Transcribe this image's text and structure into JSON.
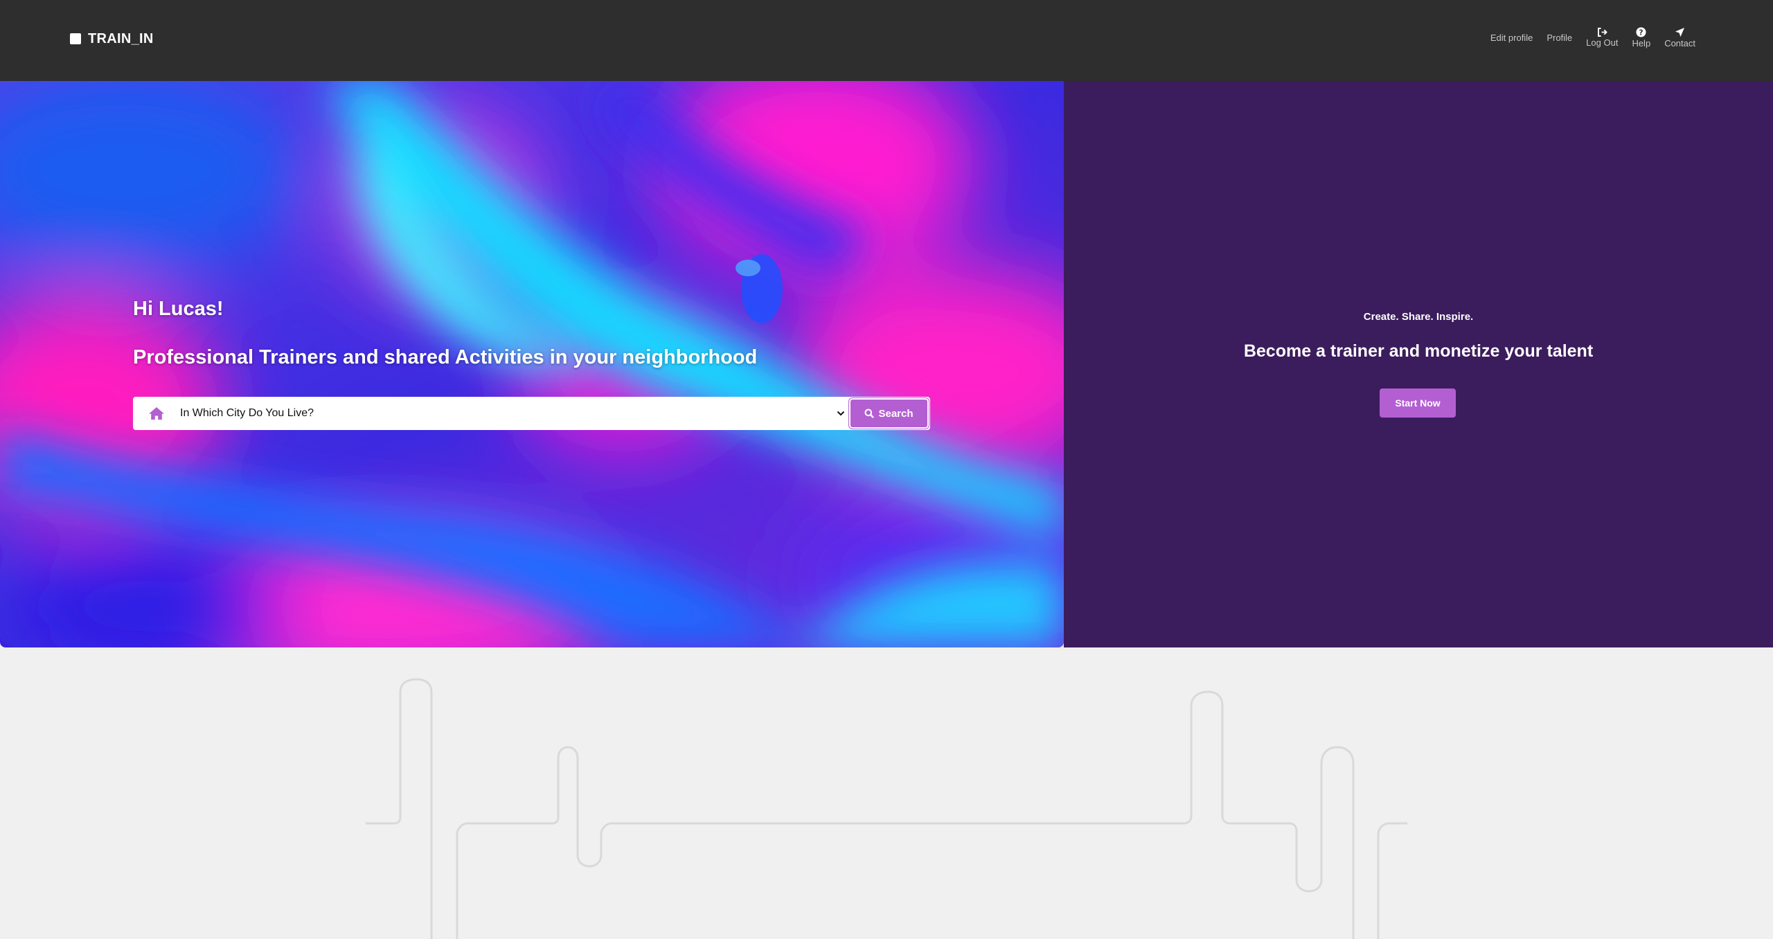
{
  "nav": {
    "brand": "TRAIN_IN",
    "links": [
      {
        "label": "Edit profile",
        "icon": null
      },
      {
        "label": "Profile",
        "icon": null
      },
      {
        "label": "Log Out",
        "icon": "sign-out-icon"
      },
      {
        "label": "Help",
        "icon": "question-circle-icon"
      },
      {
        "label": "Contact",
        "icon": "paper-plane-icon"
      }
    ]
  },
  "hero": {
    "greeting": "Hi Lucas!",
    "tagline": "Professional Trainers and shared Activities in your neighborhood",
    "search": {
      "select_value": "In Which City Do You Live?",
      "button_label": "Search"
    }
  },
  "trainer": {
    "small_text": "Create. Share. Inspire.",
    "headline": "Become a trainer and monetize your talent",
    "cta_label": "Start Now"
  },
  "colors": {
    "navbar": "#2e2e2e",
    "accent": "#b35fd1",
    "trainer_panel": "#3b1c5c",
    "page_bg": "#f0f0f0"
  }
}
